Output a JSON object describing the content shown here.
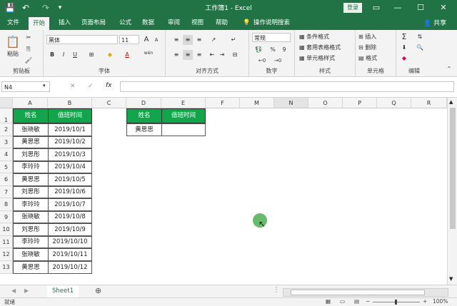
{
  "titlebar": {
    "title": "工作簿1 - Excel",
    "login": "登录",
    "save_icon": "💾",
    "undo_icon": "↶",
    "redo_icon": "↷",
    "customize_icon": "▾",
    "ribbon_display_icon": "▭",
    "minimize_icon": "—",
    "maximize_icon": "☐",
    "close_icon": "✕"
  },
  "tabs": [
    "文件",
    "开始",
    "插入",
    "页面布局",
    "公式",
    "数据",
    "审阅",
    "视图",
    "帮助"
  ],
  "tell_me": "操作说明搜索",
  "share": "共享",
  "ribbon": {
    "clipboard": {
      "paste": "粘贴",
      "label": "剪贴板"
    },
    "font": {
      "name": "黑体",
      "size": "11",
      "bold": "B",
      "italic": "I",
      "underline": "U",
      "grow": "A",
      "shrink": "A",
      "label": "字体",
      "color_a": "A",
      "wen": "wén"
    },
    "alignment": {
      "label": "对齐方式"
    },
    "number": {
      "format": "常规",
      "percent": "%",
      "comma": "9",
      "label": "数字"
    },
    "styles": {
      "conditional": "条件格式",
      "table": "套用表格格式",
      "cell": "单元格样式",
      "label": "样式"
    },
    "cells": {
      "insert": "插入",
      "delete": "删除",
      "format": "格式",
      "label": "单元格"
    },
    "editing": {
      "sum": "Σ",
      "label": "编辑"
    }
  },
  "formula_bar": {
    "name_box": "N4",
    "fx": "fx",
    "cancel": "✕",
    "enter": "✓",
    "value": ""
  },
  "columns": [
    "A",
    "B",
    "C",
    "D",
    "E",
    "F",
    "M",
    "N",
    "O",
    "P",
    "Q",
    "R"
  ],
  "rows": [
    "1",
    "2",
    "3",
    "4",
    "5",
    "6",
    "7",
    "8",
    "9",
    "10",
    "11",
    "12",
    "13"
  ],
  "table1": {
    "headers": [
      "姓名",
      "值班时间"
    ],
    "rows": [
      [
        "张晓敏",
        "2019/10/1"
      ],
      [
        "黄思思",
        "2019/10/2"
      ],
      [
        "刘思彤",
        "2019/10/3"
      ],
      [
        "李玲玲",
        "2019/10/4"
      ],
      [
        "黄思思",
        "2019/10/5"
      ],
      [
        "刘思彤",
        "2019/10/6"
      ],
      [
        "李玲玲",
        "2019/10/7"
      ],
      [
        "张晓敏",
        "2019/10/8"
      ],
      [
        "刘思彤",
        "2019/10/9"
      ],
      [
        "李玲玲",
        "2019/10/10"
      ],
      [
        "张晓敏",
        "2019/10/11"
      ],
      [
        "黄思思",
        "2019/10/12"
      ]
    ]
  },
  "table2": {
    "headers": [
      "姓名",
      "值班时间"
    ],
    "rows": [
      [
        "黄思思",
        ""
      ]
    ]
  },
  "sheet_tab": "Sheet1",
  "add_sheet": "⊕",
  "status": {
    "ready": "就绪",
    "zoom": "100%",
    "minus": "−",
    "plus": "+"
  },
  "colors": {
    "excel_green": "#217346",
    "header_fill": "#12a64c",
    "cursor": "#4caf50"
  }
}
